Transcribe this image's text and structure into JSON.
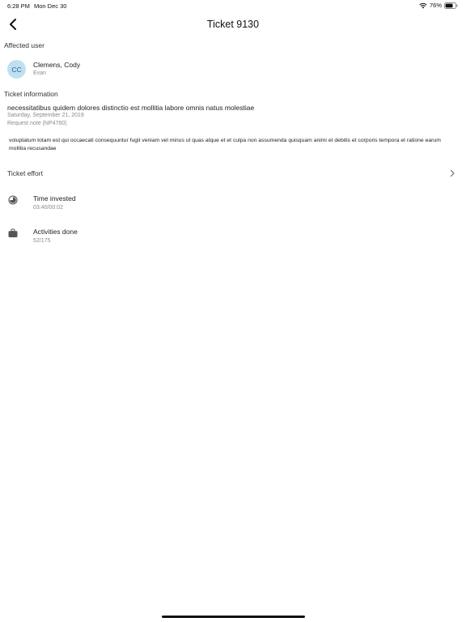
{
  "status_bar": {
    "time": "6:28 PM",
    "date": "Mon Dec 30",
    "battery_percent": "76%",
    "battery_level": 0.76,
    "icons": [
      "wifi-icon",
      "battery-icon"
    ]
  },
  "nav": {
    "back_icon": "chevron-left-icon",
    "title": "Ticket 9130"
  },
  "affected_user": {
    "header": "Affected user",
    "initials": "CC",
    "name": "Clemens, Cody",
    "subtitle": "Evan",
    "avatar_color": "#bfe0f2"
  },
  "ticket_information": {
    "header": "Ticket information",
    "subject": "necessitatibus quidem dolores distinctio est mollitia labore omnis natus molestiae",
    "date": "Saturday, September 21, 2019",
    "note": "Request note (NP4760)",
    "body": "voluptatum totam est qui occaecati consequuntur fugit veniam vel minus ut quas atque et et culpa non assumenda quisquam animi et debitis et corporis tempora et ratione earum mollitia recusandae"
  },
  "ticket_effort": {
    "label": "Ticket effort",
    "chevron_icon": "chevron-right-icon",
    "metrics": [
      {
        "icon": "clock-icon",
        "label": "Time invested",
        "value": "03:40/00:02"
      },
      {
        "icon": "briefcase-icon",
        "label": "Activities done",
        "value": "52/175"
      }
    ]
  }
}
